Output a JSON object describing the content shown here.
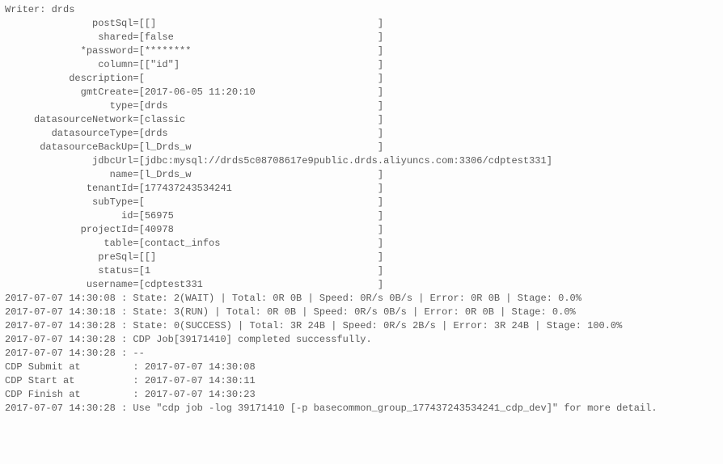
{
  "writer_header": "Writer: drds",
  "fields": [
    {
      "key": "postSql",
      "val": "[]"
    },
    {
      "key": "shared",
      "val": "false"
    },
    {
      "key": "*password",
      "val": "********"
    },
    {
      "key": "column",
      "val": "[\"id\"]"
    },
    {
      "key": "description",
      "val": ""
    },
    {
      "key": "gmtCreate",
      "val": "2017-06-05 11:20:10"
    },
    {
      "key": "type",
      "val": "drds"
    },
    {
      "key": "datasourceNetwork",
      "val": "classic"
    },
    {
      "key": "datasourceType",
      "val": "drds"
    },
    {
      "key": "datasourceBackUp",
      "val": "l_Drds_w"
    },
    {
      "key": "jdbcUrl",
      "val": "jdbc:mysql://drds5c08708617e9public.drds.aliyuncs.com:3306/cdptest331"
    },
    {
      "key": "name",
      "val": "l_Drds_w"
    },
    {
      "key": "tenantId",
      "val": "177437243534241"
    },
    {
      "key": "subType",
      "val": ""
    },
    {
      "key": "id",
      "val": "56975"
    },
    {
      "key": "projectId",
      "val": "40978"
    },
    {
      "key": "table",
      "val": "contact_infos"
    },
    {
      "key": "preSql",
      "val": "[]"
    },
    {
      "key": "status",
      "val": "1"
    },
    {
      "key": "username",
      "val": "cdptest331"
    }
  ],
  "kv_key_col_width": 22,
  "kv_val_col_width": 41,
  "kv_close_raw": "]",
  "status_lines": [
    "2017-07-07 14:30:08 : State: 2(WAIT) | Total: 0R 0B | Speed: 0R/s 0B/s | Error: 0R 0B | Stage: 0.0%",
    "2017-07-07 14:30:18 : State: 3(RUN) | Total: 0R 0B | Speed: 0R/s 0B/s | Error: 0R 0B | Stage: 0.0%",
    "2017-07-07 14:30:28 : State: 0(SUCCESS) | Total: 3R 24B | Speed: 0R/s 2B/s | Error: 3R 24B | Stage: 100.0%",
    "2017-07-07 14:30:28 : CDP Job[39171410] completed successfully.",
    "2017-07-07 14:30:28 : --"
  ],
  "cdp_lines": [
    {
      "label": "CDP Submit at",
      "value": "2017-07-07 14:30:08"
    },
    {
      "label": "CDP Start at",
      "value": "2017-07-07 14:30:11"
    },
    {
      "label": "CDP Finish at",
      "value": "2017-07-07 14:30:23"
    }
  ],
  "cdp_label_width": 22,
  "final_line": "2017-07-07 14:30:28 : Use \"cdp job -log 39171410 [-p basecommon_group_177437243534241_cdp_dev]\" for more detail."
}
